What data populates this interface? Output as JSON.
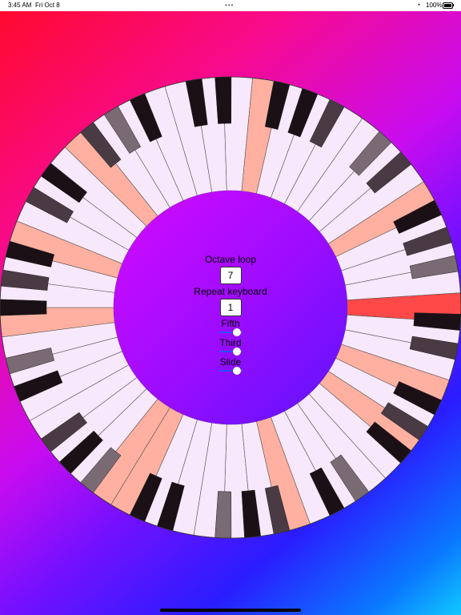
{
  "status_bar": {
    "time": "3:45 AM",
    "date": "Fri Oct 8",
    "dots": "•••",
    "battery_text": "100%"
  },
  "controls": {
    "octave_loop_label": "Octave loop",
    "octave_loop_value": "7",
    "repeat_keyboard_label": "Repeat keyboard",
    "repeat_keyboard_value": "1",
    "fifth_label": "Fifth",
    "third_label": "Third",
    "slide_label": "Slide",
    "fifth_level": 0.8,
    "third_level": 0.8,
    "slide_level": 0.8
  },
  "wheel": {
    "num_white_keys": 49,
    "highlighted_white_key": 0,
    "colors": {
      "white_key": "#f8e8fb",
      "black_key": "#1a1016",
      "highlight": "#ff4848",
      "tint": "#ffb0a0"
    }
  }
}
